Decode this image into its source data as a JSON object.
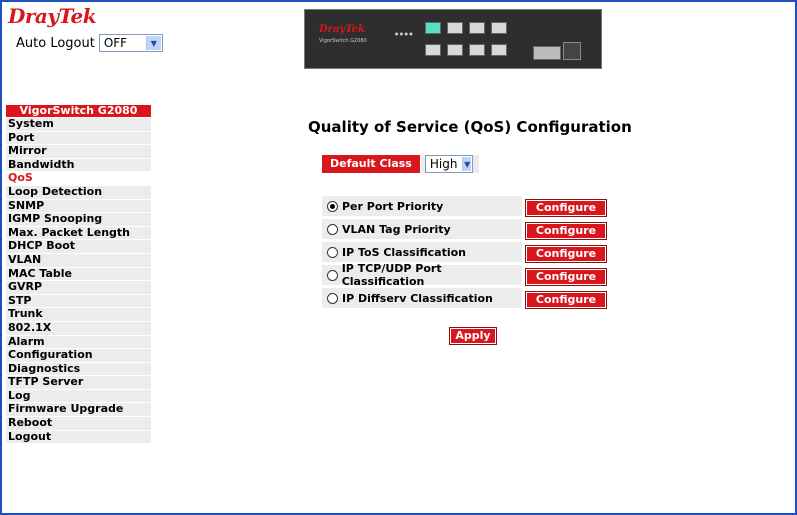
{
  "header": {
    "logo_dray": "Dray",
    "logo_tek": "Tek",
    "auto_logout_label": "Auto Logout",
    "auto_logout_value": "OFF"
  },
  "device": {
    "brand": "DrayTek",
    "model": "VigorSwitch G2080"
  },
  "menu": {
    "header": "VigorSwitch G2080",
    "items": [
      "System",
      "Port",
      "Mirror",
      "Bandwidth",
      "QoS",
      "Loop Detection",
      "SNMP",
      "IGMP Snooping",
      "Max. Packet Length",
      "DHCP Boot",
      "VLAN",
      "MAC Table",
      "GVRP",
      "STP",
      "Trunk",
      "802.1X",
      "Alarm",
      "Configuration",
      "Diagnostics",
      "TFTP Server",
      "Log",
      "Firmware Upgrade",
      "Reboot",
      "Logout"
    ],
    "active": "QoS"
  },
  "main": {
    "title": "Quality of Service (QoS) Configuration",
    "default_class_label": "Default Class",
    "default_class_value": "High",
    "options": [
      {
        "label": "Per Port Priority",
        "selected": true,
        "button": "Configure"
      },
      {
        "label": "VLAN Tag Priority",
        "selected": false,
        "button": "Configure"
      },
      {
        "label": "IP ToS Classification",
        "selected": false,
        "button": "Configure"
      },
      {
        "label": "IP TCP/UDP Port Classification",
        "selected": false,
        "button": "Configure"
      },
      {
        "label": "IP Diffserv Classification",
        "selected": false,
        "button": "Configure"
      }
    ],
    "apply_label": "Apply"
  },
  "colors": {
    "accent": "#d8161b",
    "menu_bg": "#ececec",
    "frame": "#1f4fbf"
  }
}
